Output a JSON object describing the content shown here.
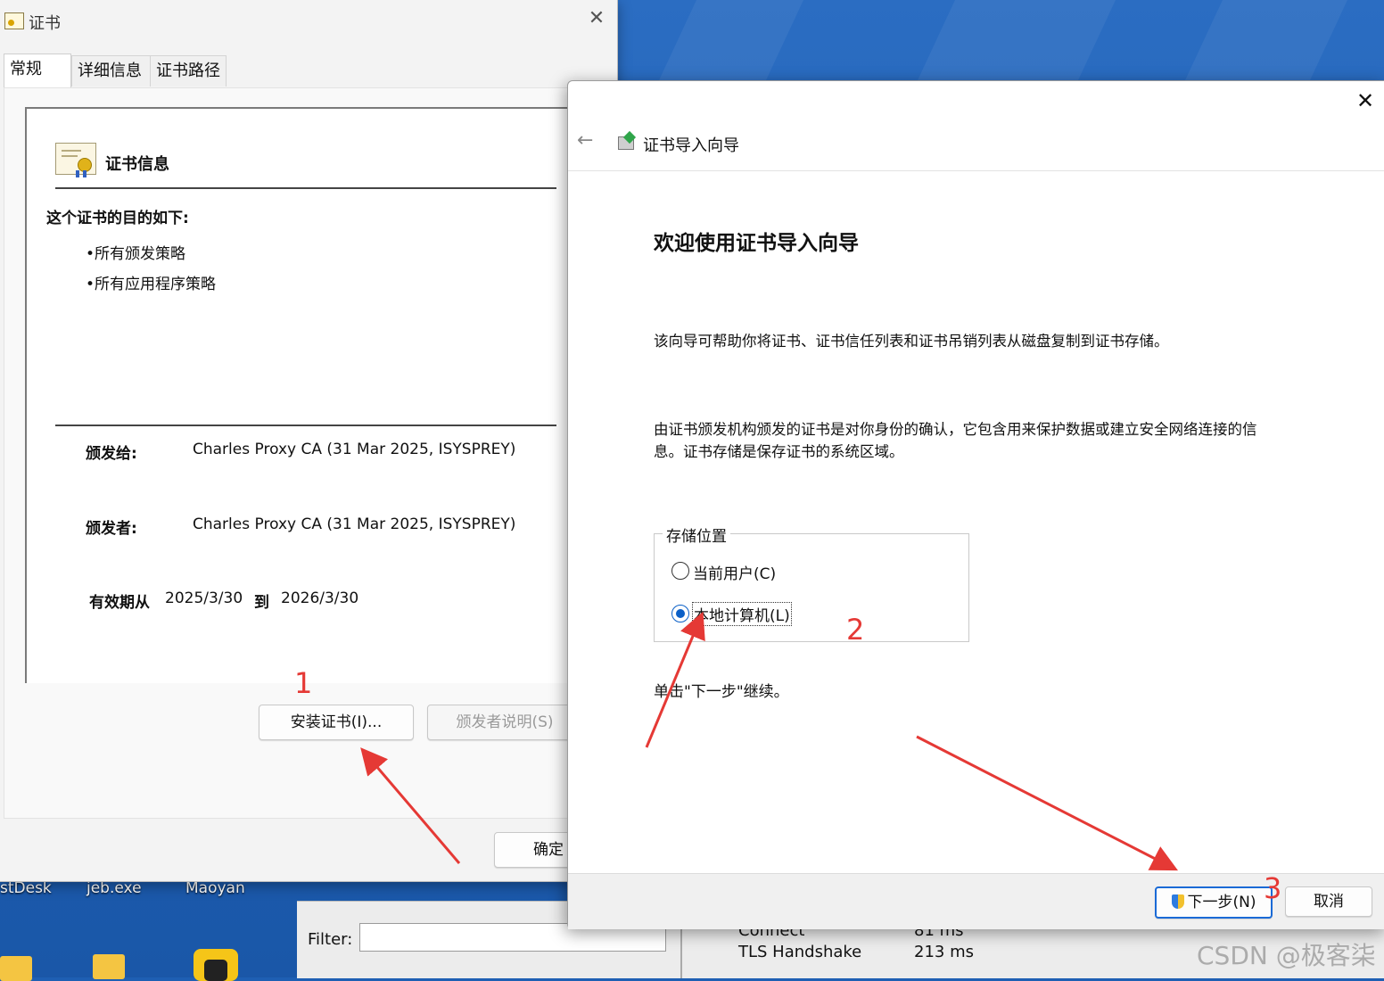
{
  "desktop": {
    "icons": [
      {
        "label": "stDesk"
      },
      {
        "label": "jeb.exe"
      },
      {
        "label": "Maoyan"
      }
    ]
  },
  "background_app": {
    "filter_label": "Filter:",
    "filter_value": "",
    "metrics": [
      {
        "name": "Connect",
        "value": "81 ms"
      },
      {
        "name": "TLS Handshake",
        "value": "213 ms"
      }
    ]
  },
  "cert_dialog": {
    "title": "证书",
    "tabs": [
      {
        "label": "常规",
        "active": true
      },
      {
        "label": "详细信息",
        "active": false
      },
      {
        "label": "证书路径",
        "active": false
      }
    ],
    "info_heading": "证书信息",
    "purpose_heading": "这个证书的目的如下:",
    "purposes": [
      "•所有颁发策略",
      "•所有应用程序策略"
    ],
    "issued_to_label": "颁发给:",
    "issued_to_value": "Charles Proxy CA (31 Mar 2025, ISYSPREY)",
    "issued_by_label": "颁发者:",
    "issued_by_value": "Charles Proxy CA (31 Mar 2025, ISYSPREY)",
    "valid_from_label": "有效期从",
    "valid_from_value": "2025/3/30",
    "valid_to_label": "到",
    "valid_to_value": "2026/3/30",
    "install_button": "安装证书(I)...",
    "issuer_statement_button": "颁发者说明(S)",
    "ok_button": "确定"
  },
  "wizard": {
    "title": "证书导入向导",
    "heading": "欢迎使用证书导入向导",
    "para1": "该向导可帮助你将证书、证书信任列表和证书吊销列表从磁盘复制到证书存储。",
    "para2_line1": "由证书颁发机构颁发的证书是对你身份的确认，它包含用来保护数据或建立安全网络连接的信",
    "para2_line2": "息。证书存储是保存证书的系统区域。",
    "store_group_label": "存储位置",
    "options": [
      {
        "label": "当前用户(C)",
        "selected": false
      },
      {
        "label": "本地计算机(L)",
        "selected": true
      }
    ],
    "continue_hint": "单击\"下一步\"继续。",
    "next_button": "下一步(N)",
    "cancel_button": "取消"
  },
  "annotations": {
    "step1": "1",
    "step2": "2",
    "step3": "3",
    "arrow_color": "#e53935"
  },
  "watermark": "CSDN @极客柒"
}
